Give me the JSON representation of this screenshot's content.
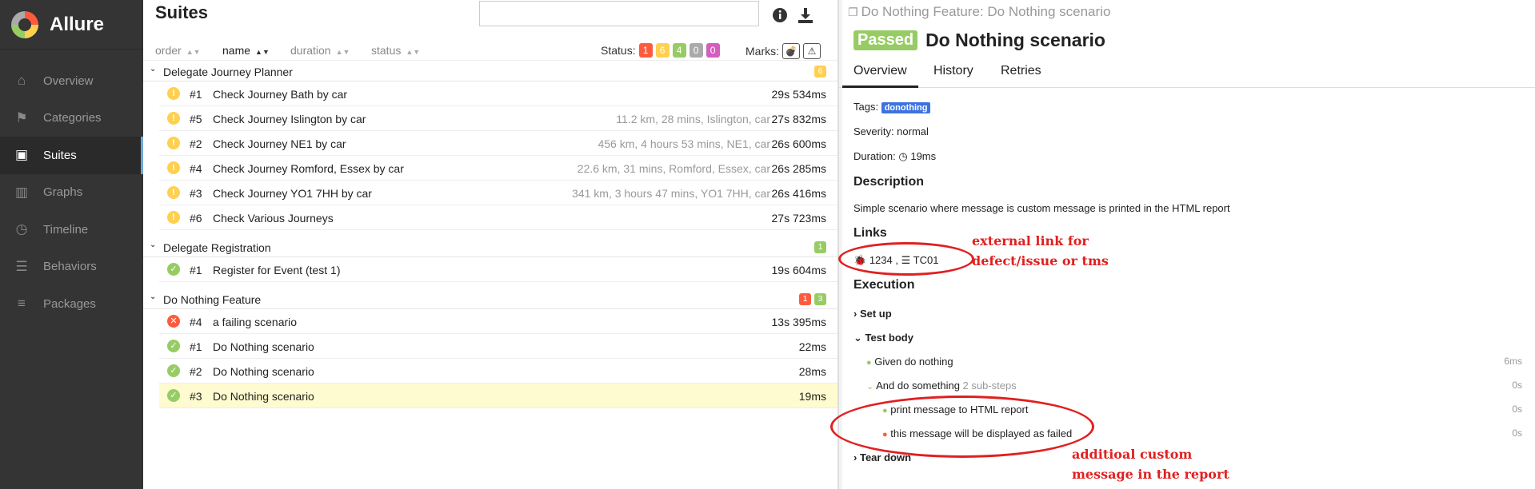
{
  "app": {
    "name": "Allure"
  },
  "sidebar": {
    "items": [
      {
        "label": "Overview",
        "icon": "home-icon"
      },
      {
        "label": "Categories",
        "icon": "flag-icon"
      },
      {
        "label": "Suites",
        "icon": "briefcase-icon"
      },
      {
        "label": "Graphs",
        "icon": "bar-chart-icon"
      },
      {
        "label": "Timeline",
        "icon": "clock-icon"
      },
      {
        "label": "Behaviors",
        "icon": "list-icon"
      },
      {
        "label": "Packages",
        "icon": "align-left-icon"
      }
    ],
    "active": "Suites"
  },
  "main": {
    "title": "Suites",
    "search": {
      "placeholder": "",
      "value": ""
    },
    "sort": {
      "order": "order",
      "name": "name",
      "duration": "duration",
      "status": "status"
    },
    "status_label": "Status:",
    "status_counts": [
      {
        "count": "1",
        "color": "#fd5a3e"
      },
      {
        "count": "6",
        "color": "#ffd050"
      },
      {
        "count": "4",
        "color": "#97cc64"
      },
      {
        "count": "0",
        "color": "#aaaaaa"
      },
      {
        "count": "0",
        "color": "#d35ebe"
      }
    ],
    "marks_label": "Marks:",
    "groups": [
      {
        "name": "Delegate Journey Planner",
        "badges": [
          {
            "count": "6",
            "color": "#ffd050"
          }
        ],
        "rows": [
          {
            "status": "broken",
            "num": "#1",
            "name": "Check Journey Bath by car",
            "params": "",
            "duration": "29s 534ms"
          },
          {
            "status": "broken",
            "num": "#5",
            "name": "Check Journey Islington by car",
            "params": "11.2 km, 28 mins, Islington, car",
            "duration": "27s 832ms"
          },
          {
            "status": "broken",
            "num": "#2",
            "name": "Check Journey NE1 by car",
            "params": "456 km, 4 hours 53 mins, NE1, car",
            "duration": "26s 600ms"
          },
          {
            "status": "broken",
            "num": "#4",
            "name": "Check Journey Romford, Essex by car",
            "params": "22.6 km, 31 mins, Romford, Essex, car",
            "duration": "26s 285ms"
          },
          {
            "status": "broken",
            "num": "#3",
            "name": "Check Journey YO1 7HH by car",
            "params": "341 km, 3 hours 47 mins, YO1 7HH, car",
            "duration": "26s 416ms"
          },
          {
            "status": "broken",
            "num": "#6",
            "name": "Check Various Journeys",
            "params": "",
            "duration": "27s 723ms"
          }
        ]
      },
      {
        "name": "Delegate Registration",
        "badges": [
          {
            "count": "1",
            "color": "#97cc64"
          }
        ],
        "rows": [
          {
            "status": "passed",
            "num": "#1",
            "name": "Register for Event (test 1)",
            "params": "",
            "duration": "19s 604ms"
          }
        ]
      },
      {
        "name": "Do Nothing Feature",
        "badges": [
          {
            "count": "1",
            "color": "#fd5a3e"
          },
          {
            "count": "3",
            "color": "#97cc64"
          }
        ],
        "rows": [
          {
            "status": "failed",
            "num": "#4",
            "name": "a failing scenario",
            "params": "",
            "duration": "13s 395ms"
          },
          {
            "status": "passed",
            "num": "#1",
            "name": "Do Nothing scenario",
            "params": "",
            "duration": "22ms"
          },
          {
            "status": "passed",
            "num": "#2",
            "name": "Do Nothing scenario",
            "params": "",
            "duration": "28ms"
          },
          {
            "status": "passed",
            "num": "#3",
            "name": "Do Nothing scenario",
            "params": "",
            "duration": "19ms",
            "selected": true
          }
        ]
      }
    ]
  },
  "detail": {
    "breadcrumb": "Do Nothing Feature: Do Nothing scenario",
    "status_badge": "Passed",
    "title": "Do Nothing scenario",
    "tabs": [
      "Overview",
      "History",
      "Retries"
    ],
    "tags_label": "Tags:",
    "tag": "donothing",
    "severity": "Severity: normal",
    "duration_label": "Duration:",
    "duration": "19ms",
    "description_title": "Description",
    "description": "Simple scenario where message is custom message is printed in the HTML report",
    "links_title": "Links",
    "link_issue": "1234",
    "link_sep": ",",
    "link_tms": "TC01",
    "execution_title": "Execution",
    "setup": "Set up",
    "test_body": "Test body",
    "steps": [
      {
        "name": "Given do nothing",
        "duration": "6ms"
      },
      {
        "name": "And do something",
        "sub": "2 sub-steps",
        "duration": "0s"
      },
      {
        "name": "print message to HTML report",
        "duration": "0s"
      },
      {
        "name": "this message will be displayed as failed",
        "duration": "0s"
      }
    ],
    "teardown": "Tear down"
  },
  "annotations": {
    "links_note_1": "external link for",
    "links_note_2": "defect/issue or tms",
    "custom_note_1": "additioal custom",
    "custom_note_2": "message in the report",
    "color": "#e02020"
  }
}
